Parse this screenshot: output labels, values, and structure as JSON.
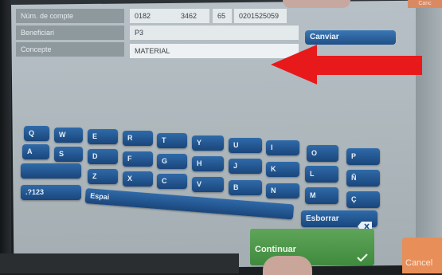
{
  "form": {
    "account": {
      "label": "Núm. de compte",
      "parts": [
        "0182",
        "3462",
        "65",
        "0201525059"
      ]
    },
    "beneficiary": {
      "label": "Beneficiari",
      "value": "P3"
    },
    "concept": {
      "label": "Concepte",
      "value": "MATERIAL"
    },
    "change_button": "Canviar"
  },
  "keyboard": {
    "row1": [
      "Q",
      "W",
      "E",
      "R",
      "T",
      "Y",
      "U",
      "I",
      "O",
      "P"
    ],
    "row2": [
      "A",
      "S",
      "D",
      "F",
      "G",
      "H",
      "J",
      "K",
      "L",
      "Ñ"
    ],
    "row3": [
      "Z",
      "X",
      "C",
      "V",
      "B",
      "N",
      "M",
      "Ç"
    ],
    "numbers_key": ".?123",
    "space_key": "Espai",
    "delete_key": "Esborrar",
    "continue_button": "Continuar",
    "cancel_button": "Cancel",
    "top_right_button": "Canc"
  },
  "colors": {
    "arrow": "#e8191b",
    "key": "#2a5f9c",
    "continue": "#4f9a4c",
    "cancel": "#e88e58"
  }
}
